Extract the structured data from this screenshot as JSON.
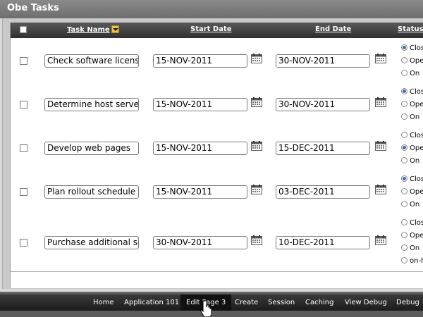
{
  "region": {
    "title": "Obe Tasks"
  },
  "grid": {
    "headers": {
      "task_name": "Task Name",
      "start_date": "Start Date",
      "end_date": "End Date",
      "status": "Status"
    },
    "rows": [
      {
        "task_name": "Check software licenses",
        "start_date": "15-NOV-2011",
        "end_date": "30-NOV-2011",
        "status_options": [
          "Clos",
          "Ope",
          "On"
        ],
        "selected": 0
      },
      {
        "task_name": "Determine host server",
        "start_date": "15-NOV-2011",
        "end_date": "30-NOV-2011",
        "status_options": [
          "Clos",
          "Ope",
          "On"
        ],
        "selected": 0
      },
      {
        "task_name": "Develop web pages",
        "start_date": "15-NOV-2011",
        "end_date": "15-DEC-2011",
        "status_options": [
          "Clos",
          "Ope",
          "On"
        ],
        "selected": 1
      },
      {
        "task_name": "Plan rollout schedule",
        "start_date": "15-NOV-2011",
        "end_date": "03-DEC-2011",
        "status_options": [
          "Clos",
          "Ope",
          "On"
        ],
        "selected": 0
      },
      {
        "task_name": "Purchase additional soft",
        "start_date": "30-NOV-2011",
        "end_date": "10-DEC-2011",
        "status_options": [
          "Clos",
          "Ope",
          "On",
          "on-h"
        ],
        "selected": -1
      }
    ]
  },
  "developer_toolbar": {
    "items": [
      "Home",
      "Application 101",
      "Edit Page 3",
      "Create",
      "Session",
      "Caching",
      "View Debug",
      "Debug"
    ],
    "active_index": 2
  },
  "colors": {
    "radio_selected": "#3b6fb6",
    "sort_indicator": "#e8c547"
  }
}
